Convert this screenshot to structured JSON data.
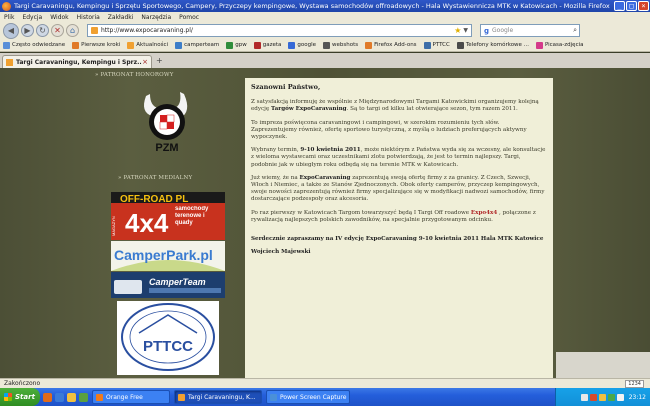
{
  "window": {
    "title": "Targi Caravaningu, Kempingu i Sprzętu Sportowego, Campery, Przyczepy kempingowe, Wystawa samochodów offroadowych - Hala Wystawiennicza MTK w Katowicach - Mozilla Firefox",
    "minimize": "_",
    "maximize": "□",
    "close": "×"
  },
  "menu": [
    "Plik",
    "Edycja",
    "Widok",
    "Historia",
    "Zakładki",
    "Narzędzia",
    "Pomoc"
  ],
  "nav": {
    "back": "◀",
    "forward": "▶",
    "reload": "↻",
    "stop": "✕",
    "home": "⌂",
    "url": "http://www.expocaravaning.pl/",
    "search_placeholder": "Google",
    "search_engine_initial": "g"
  },
  "bookmarks": [
    {
      "label": "Często odwiedzane",
      "color": "#5a8fd8"
    },
    {
      "label": "Pierwsze kroki",
      "color": "#e07a28"
    },
    {
      "label": "Aktualności",
      "color": "#f0a030"
    },
    {
      "label": "camperteam",
      "color": "#3d7ec8"
    },
    {
      "label": "gpw",
      "color": "#2f8d3a"
    },
    {
      "label": "gazeta",
      "color": "#b22a2a"
    },
    {
      "label": "google",
      "color": "#3669d6"
    },
    {
      "label": "webshots",
      "color": "#555555"
    },
    {
      "label": "Firefox Add-ons",
      "color": "#e07a28"
    },
    {
      "label": "PTTCC",
      "color": "#3d6ea8"
    },
    {
      "label": "Telefony komórkowe ...",
      "color": "#4a4a4a"
    },
    {
      "label": "Picasa-zdjęcia",
      "color": "#d43a8a"
    }
  ],
  "tab": {
    "label": "Targi Caravaningu, Kempingu i Sprz...",
    "close": "×",
    "new_tab": "+"
  },
  "sidebar": {
    "patronat_honorowy": "» PATRONAT HONOROWY",
    "patronat_medialny": "» PATRONAT MEDIALNY",
    "pzm_logo_text": "PZM",
    "offroad_logo_text": "OFF-ROAD PL",
    "offroad_4x4": "4x4",
    "offroad_sub": "samochody terenowe i quady",
    "offroad_vertical": "MAGAZYN",
    "camperpark_text": "CamperPark.pl",
    "camperteam_text": "CamperTeam",
    "pttcc_text": "PTTCC"
  },
  "article": {
    "salutation": "Szanowni Państwo,",
    "p1_a": "Z satysfakcją informuję że wspólnie z Międzynarodowymi Targami Katowickimi organizujemy kolejną edycję ",
    "p1_b": "Targów ExpoCaravaning",
    "p1_c": ". Są to targi od kilku lat otwierające sezon, tym razem 2011.",
    "p2": "To impreza poświęcona caravaningowi i campingowi, w szerokim rozumieniu tych słów. Zaprezentujemy również, ofertę sportowo turystyczną, z myślą o ludziach preferujących aktywny wypoczynek.",
    "p3_a": "Wybrany termin, ",
    "p3_b": "9-10 kwietnia 2011",
    "p3_c": ", może niektórym z Państwa wyda się za wczesny, ale konsultacje z wieloma wystawcami oraz uczestnikami zlotu potwierdzają, że jest to termin najlepszy. Targi, podobnie jak w ubiegłym roku odbędą się na terenie MTK w Katowicach.",
    "p4_a": "Już wiemy, że na ",
    "p4_b": "ExpoCaravaning",
    "p4_c": " zaprezentują swoją ofertę  firmy z za granicy. Z Czech, Szwecji, Włoch i Niemiec, a także ze Stanów Zjednoczonych. Obok oferty camperów, przyczep kempingowych, swoje nowości zaprezentują również firmy specjalizujące się w modyfikacji nadwozi samochodów, firmy dostarczające podzespoły oraz akcesoria.",
    "p5_a": "Po raz pierwszy w Katowicach Targom towarzyszyć będą I Targi Off roadowe  ",
    "p5_b": "Expo4x4",
    "p5_c": " , połączone z rywalizacją najlepszych polskich zawodników, na specjalnie przygotowanym odcinku.",
    "p6": "Serdecznie zapraszamy na IV edycję ExpoCaravaning  9-10 kwietnia 2011 Hala MTK Katowice",
    "signature": "Wojciech Majewski"
  },
  "status": {
    "text": "Zakończono",
    "addon": "1234"
  },
  "taskbar": {
    "start": "Start",
    "tasks": [
      {
        "label": "Orange Free",
        "color": "#f07a1a"
      },
      {
        "label": "Targi Caravaningu, K...",
        "color": "#f0a030"
      },
      {
        "label": "Power Screen Capture",
        "color": "#4a90d8"
      }
    ],
    "clock": "23:12"
  },
  "colors": {
    "article_bg": "#f0efd8",
    "page_bg": "#4f5236",
    "highlight_red": "#b02a2a"
  }
}
